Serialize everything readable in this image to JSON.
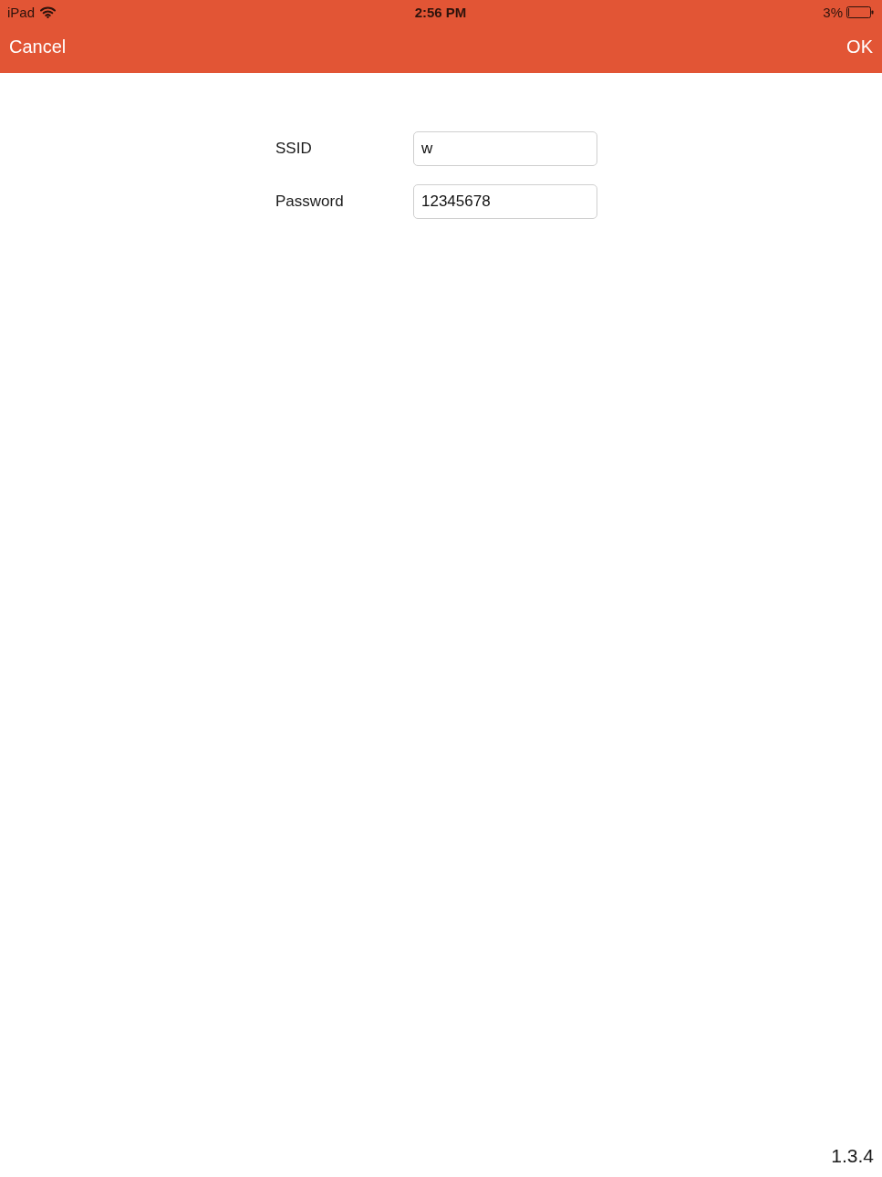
{
  "status_bar": {
    "carrier": "iPad",
    "time": "2:56 PM",
    "battery": "3%"
  },
  "nav_bar": {
    "left_button": "Cancel",
    "right_button": "OK"
  },
  "form": {
    "fields": [
      {
        "label": "SSID",
        "value": "w"
      },
      {
        "label": "Password",
        "value": "12345678"
      }
    ]
  },
  "version": "1.3.4"
}
